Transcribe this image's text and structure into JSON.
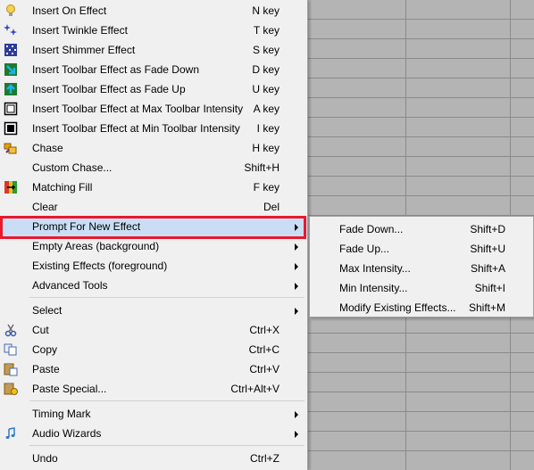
{
  "menu": {
    "items": [
      {
        "label": "Insert On Effect",
        "key": "N key",
        "icon": "bulb-icon"
      },
      {
        "label": "Insert Twinkle Effect",
        "key": "T key",
        "icon": "twinkle-icon"
      },
      {
        "label": "Insert Shimmer Effect",
        "key": "S key",
        "icon": "shimmer-icon"
      },
      {
        "label": "Insert Toolbar Effect as Fade Down",
        "key": "D key",
        "icon": "fade-down-icon"
      },
      {
        "label": "Insert Toolbar Effect as Fade Up",
        "key": "U key",
        "icon": "fade-up-icon"
      },
      {
        "label": "Insert Toolbar Effect at Max Toolbar Intensity",
        "key": "A key",
        "icon": "max-intensity-icon"
      },
      {
        "label": "Insert Toolbar Effect at Min Toolbar Intensity",
        "key": "I key",
        "icon": "min-intensity-icon"
      },
      {
        "label": "Chase",
        "key": "H key",
        "icon": "chase-icon"
      },
      {
        "label": "Custom Chase...",
        "key": "Shift+H"
      },
      {
        "label": "Matching Fill",
        "key": "F key",
        "icon": "matching-fill-icon"
      },
      {
        "label": "Clear",
        "key": "Del"
      },
      {
        "label": "Prompt For New Effect",
        "submenu": true
      },
      {
        "label": "Empty Areas (background)",
        "submenu": true
      },
      {
        "label": "Existing Effects (foreground)",
        "submenu": true
      },
      {
        "label": "Advanced Tools",
        "submenu": true
      },
      {
        "label": "Select",
        "submenu": true
      },
      {
        "label": "Cut",
        "key": "Ctrl+X",
        "icon": "scissors-icon"
      },
      {
        "label": "Copy",
        "key": "Ctrl+C",
        "icon": "copy-icon"
      },
      {
        "label": "Paste",
        "key": "Ctrl+V",
        "icon": "paste-icon"
      },
      {
        "label": "Paste Special...",
        "key": "Ctrl+Alt+V",
        "icon": "paste-special-icon"
      },
      {
        "label": "Timing Mark",
        "submenu": true
      },
      {
        "label": "Audio Wizards",
        "submenu": true,
        "icon": "music-note-icon"
      },
      {
        "label": "Undo",
        "key": "Ctrl+Z"
      }
    ]
  },
  "submenu": {
    "items": [
      {
        "label": "Fade Down...",
        "key": "Shift+D"
      },
      {
        "label": "Fade Up...",
        "key": "Shift+U"
      },
      {
        "label": "Max Intensity...",
        "key": "Shift+A"
      },
      {
        "label": "Min Intensity...",
        "key": "Shift+I"
      },
      {
        "label": "Modify Existing Effects...",
        "key": "Shift+M"
      }
    ]
  },
  "colors": {
    "highlight": "#c9def5",
    "annotation_box": "#e8192c",
    "menu_bg": "#f0f0f0",
    "canvas_bg": "#b4b4b4"
  }
}
